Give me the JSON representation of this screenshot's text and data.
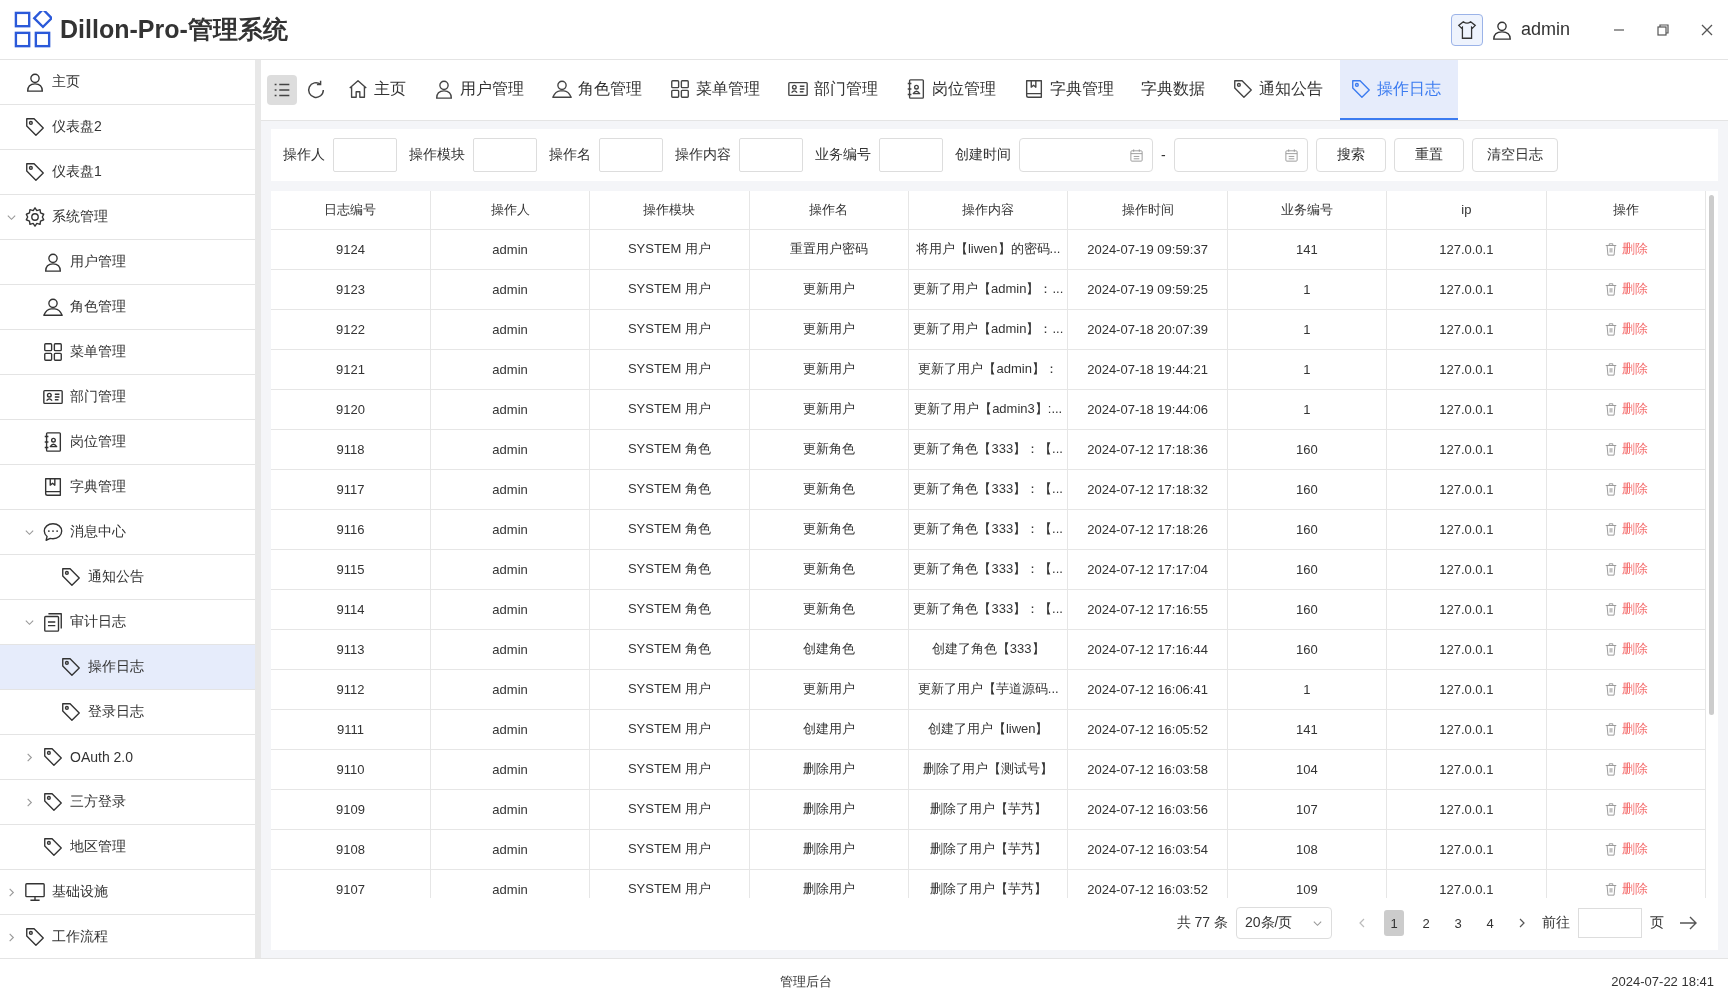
{
  "header": {
    "title": "Dillon-Pro-管理系统",
    "user": "admin"
  },
  "sidebar": {
    "items": [
      {
        "label": "主页",
        "kind": "user",
        "selected": false
      },
      {
        "label": "仪表盘2",
        "kind": "tag",
        "selected": false
      },
      {
        "label": "仪表盘1",
        "kind": "tag",
        "selected": false
      },
      {
        "label": "系统管理",
        "kind": "gear",
        "selected": false,
        "expanded": true,
        "children": [
          {
            "label": "用户管理",
            "kind": "user",
            "selected": false
          },
          {
            "label": "角色管理",
            "kind": "person",
            "selected": false
          },
          {
            "label": "菜单管理",
            "kind": "grid",
            "selected": false
          },
          {
            "label": "部门管理",
            "kind": "card",
            "selected": false
          },
          {
            "label": "岗位管理",
            "kind": "badge",
            "selected": false
          },
          {
            "label": "字典管理",
            "kind": "book",
            "selected": false
          },
          {
            "label": "消息中心",
            "kind": "chat",
            "selected": false,
            "expanded": true,
            "children": [
              {
                "label": "通知公告",
                "kind": "tag",
                "selected": false
              }
            ]
          },
          {
            "label": "审计日志",
            "kind": "doc",
            "selected": false,
            "expanded": true,
            "children": [
              {
                "label": "操作日志",
                "kind": "tag",
                "selected": true
              },
              {
                "label": "登录日志",
                "kind": "tag",
                "selected": false
              }
            ]
          },
          {
            "label": "OAuth 2.0",
            "kind": "tag",
            "selected": false,
            "expanded": false
          },
          {
            "label": "三方登录",
            "kind": "tag",
            "selected": false,
            "expanded": false
          },
          {
            "label": "地区管理",
            "kind": "tag",
            "selected": false
          }
        ]
      },
      {
        "label": "基础设施",
        "kind": "monitor",
        "selected": false,
        "expanded": false
      },
      {
        "label": "工作流程",
        "kind": "tag",
        "selected": false,
        "expanded": false
      }
    ]
  },
  "tabs": [
    {
      "label": "主页",
      "kind": "home",
      "selected": false
    },
    {
      "label": "用户管理",
      "kind": "user",
      "selected": false
    },
    {
      "label": "角色管理",
      "kind": "person",
      "selected": false
    },
    {
      "label": "菜单管理",
      "kind": "grid",
      "selected": false
    },
    {
      "label": "部门管理",
      "kind": "card",
      "selected": false
    },
    {
      "label": "岗位管理",
      "kind": "badge",
      "selected": false
    },
    {
      "label": "字典管理",
      "kind": "book",
      "selected": false
    },
    {
      "label": "字典数据",
      "kind": "none",
      "selected": false
    },
    {
      "label": "通知公告",
      "kind": "tag",
      "selected": false
    },
    {
      "label": "操作日志",
      "kind": "tag",
      "selected": true
    }
  ],
  "filters": {
    "fields": [
      {
        "label": "操作人"
      },
      {
        "label": "操作模块"
      },
      {
        "label": "操作名"
      },
      {
        "label": "操作内容"
      },
      {
        "label": "业务编号"
      }
    ],
    "date_range": {
      "label": "创建时间",
      "separator": "-"
    },
    "buttons": [
      "搜索",
      "重置",
      "清空日志"
    ]
  },
  "table": {
    "columns": [
      "日志编号",
      "操作人",
      "操作模块",
      "操作名",
      "操作内容",
      "操作时间",
      "业务编号",
      "ip",
      "操作"
    ],
    "rows": [
      {
        "cells": [
          "9124",
          "admin",
          "SYSTEM 用户",
          "重置用户密码",
          "将用户【liwen】的密码...",
          "2024-07-19 09:59:37",
          "141",
          "127.0.0.1"
        ],
        "action": "删除"
      },
      {
        "cells": [
          "9123",
          "admin",
          "SYSTEM 用户",
          "更新用户",
          "更新了用户【admin】：...",
          "2024-07-19 09:59:25",
          "1",
          "127.0.0.1"
        ],
        "action": "删除"
      },
      {
        "cells": [
          "9122",
          "admin",
          "SYSTEM 用户",
          "更新用户",
          "更新了用户【admin】：...",
          "2024-07-18 20:07:39",
          "1",
          "127.0.0.1"
        ],
        "action": "删除"
      },
      {
        "cells": [
          "9121",
          "admin",
          "SYSTEM 用户",
          "更新用户",
          "更新了用户【admin】：",
          "2024-07-18 19:44:21",
          "1",
          "127.0.0.1"
        ],
        "action": "删除"
      },
      {
        "cells": [
          "9120",
          "admin",
          "SYSTEM 用户",
          "更新用户",
          "更新了用户【admin3】:...",
          "2024-07-18 19:44:06",
          "1",
          "127.0.0.1"
        ],
        "action": "删除"
      },
      {
        "cells": [
          "9118",
          "admin",
          "SYSTEM 角色",
          "更新角色",
          "更新了角色【333】：【...",
          "2024-07-12 17:18:36",
          "160",
          "127.0.0.1"
        ],
        "action": "删除"
      },
      {
        "cells": [
          "9117",
          "admin",
          "SYSTEM 角色",
          "更新角色",
          "更新了角色【333】：【...",
          "2024-07-12 17:18:32",
          "160",
          "127.0.0.1"
        ],
        "action": "删除"
      },
      {
        "cells": [
          "9116",
          "admin",
          "SYSTEM 角色",
          "更新角色",
          "更新了角色【333】：【...",
          "2024-07-12 17:18:26",
          "160",
          "127.0.0.1"
        ],
        "action": "删除"
      },
      {
        "cells": [
          "9115",
          "admin",
          "SYSTEM 角色",
          "更新角色",
          "更新了角色【333】：【...",
          "2024-07-12 17:17:04",
          "160",
          "127.0.0.1"
        ],
        "action": "删除"
      },
      {
        "cells": [
          "9114",
          "admin",
          "SYSTEM 角色",
          "更新角色",
          "更新了角色【333】：【...",
          "2024-07-12 17:16:55",
          "160",
          "127.0.0.1"
        ],
        "action": "删除"
      },
      {
        "cells": [
          "9113",
          "admin",
          "SYSTEM 角色",
          "创建角色",
          "创建了角色【333】",
          "2024-07-12 17:16:44",
          "160",
          "127.0.0.1"
        ],
        "action": "删除"
      },
      {
        "cells": [
          "9112",
          "admin",
          "SYSTEM 用户",
          "更新用户",
          "更新了用户【芋道源码...",
          "2024-07-12 16:06:41",
          "1",
          "127.0.0.1"
        ],
        "action": "删除"
      },
      {
        "cells": [
          "9111",
          "admin",
          "SYSTEM 用户",
          "创建用户",
          "创建了用户【liwen】",
          "2024-07-12 16:05:52",
          "141",
          "127.0.0.1"
        ],
        "action": "删除"
      },
      {
        "cells": [
          "9110",
          "admin",
          "SYSTEM 用户",
          "删除用户",
          "删除了用户【测试号】",
          "2024-07-12 16:03:58",
          "104",
          "127.0.0.1"
        ],
        "action": "删除"
      },
      {
        "cells": [
          "9109",
          "admin",
          "SYSTEM 用户",
          "删除用户",
          "删除了用户【芋艿】",
          "2024-07-12 16:03:56",
          "107",
          "127.0.0.1"
        ],
        "action": "删除"
      },
      {
        "cells": [
          "9108",
          "admin",
          "SYSTEM 用户",
          "删除用户",
          "删除了用户【芋艿】",
          "2024-07-12 16:03:54",
          "108",
          "127.0.0.1"
        ],
        "action": "删除"
      },
      {
        "cells": [
          "9107",
          "admin",
          "SYSTEM 用户",
          "删除用户",
          "删除了用户【芋艿】",
          "2024-07-12 16:03:52",
          "109",
          "127.0.0.1"
        ],
        "action": "删除"
      }
    ]
  },
  "pagination": {
    "total": "共 77 条",
    "page_size": "20条/页",
    "pages": [
      {
        "label": "1",
        "selected": true
      },
      {
        "label": "2",
        "selected": false
      },
      {
        "label": "3",
        "selected": false
      },
      {
        "label": "4",
        "selected": false
      }
    ],
    "goto_label": "前往",
    "goto_suffix": "页"
  },
  "footer": {
    "center": "管理后台",
    "time": "2024-07-22 18:41"
  }
}
